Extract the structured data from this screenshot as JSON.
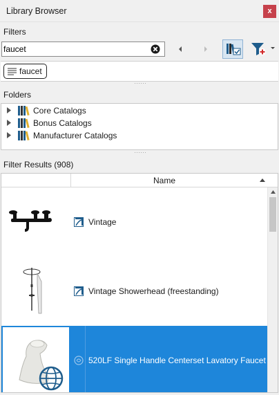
{
  "window": {
    "title": "Library Browser",
    "close_label": "x"
  },
  "filters": {
    "label": "Filters",
    "search_value": "faucet",
    "tags": [
      {
        "label": "faucet"
      }
    ]
  },
  "folders": {
    "label": "Folders",
    "items": [
      {
        "label": "Core Catalogs"
      },
      {
        "label": "Bonus Catalogs"
      },
      {
        "label": "Manufacturer Catalogs"
      }
    ]
  },
  "results": {
    "label": "Filter Results (908)",
    "column_name": "Name",
    "rows": [
      {
        "name": "Vintage",
        "selected": false
      },
      {
        "name": "Vintage Showerhead (freestanding)",
        "selected": false
      },
      {
        "name": "520LF Single Handle Centerset Lavatory Faucet",
        "selected": true
      }
    ]
  },
  "colors": {
    "selection": "#1e86da",
    "close_button": "#c6414b",
    "accent_icon": "#1f5d8c"
  }
}
